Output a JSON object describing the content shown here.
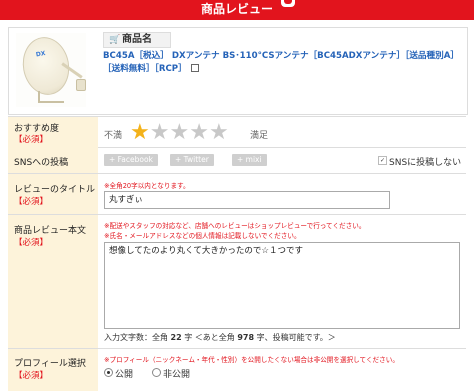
{
  "header": {
    "title": "商品レビュー"
  },
  "product": {
    "label": "商品名",
    "cart_icon": "cart-icon",
    "name": "BC45A［税込］ DXアンテナ BS･110°CSアンテナ［BC45ADXアンテナ］［送品種別A］［送料無料］［RCP］",
    "external_icon": "external-link-icon",
    "image_logo": "DX"
  },
  "form": {
    "rating": {
      "label": "おすすめ度",
      "required": "【必須】",
      "low": "不満",
      "high": "満足",
      "value": 1,
      "max": 5
    },
    "sns": {
      "label": "SNSへの投稿",
      "buttons": [
        "+ Facebook",
        "+ Twitter",
        "+ mixi"
      ],
      "no_post_label": "SNSに投稿しない",
      "no_post_checked": true
    },
    "title": {
      "label": "レビューのタイトル",
      "required": "【必須】",
      "note": "※全角20字以内となります。",
      "value": "丸すぎぃ"
    },
    "body": {
      "label": "商品レビュー本文",
      "required": "【必須】",
      "notes": [
        "※配送やスタッフの対応など、店舗へのレビューはショップレビューで行ってください。",
        "※氏名・メールアドレスなどの個人情報は記載しないでください。"
      ],
      "value": "想像してたのより丸くて大きかったので☆１つです",
      "counter_prefix": "入力文字数：全角",
      "counter_count": "22",
      "counter_mid": "字 ＜あと全角",
      "counter_remaining": "978",
      "counter_suffix": "字、投稿可能です。＞"
    },
    "profile": {
      "label": "プロフィール選択",
      "required": "【必須】",
      "note": "※プロフィール（ニックネーム・年代・性別）を公開したくない場合は非公開を選択してください。",
      "options": [
        "公開",
        "非公開"
      ],
      "selected": "公開"
    }
  }
}
